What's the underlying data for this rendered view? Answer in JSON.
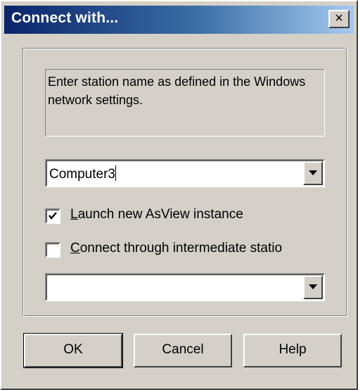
{
  "window": {
    "title": "Connect with...",
    "close_glyph": "×"
  },
  "info_text": "Enter station name as defined in the Windows network settings.",
  "station_combo": {
    "value": "Computer3",
    "dropdown_icon": "chevron-down-icon"
  },
  "launch_checkbox": {
    "mnemonic": "L",
    "label_rest": "aunch new AsView instance",
    "checked": true
  },
  "intermediate_checkbox": {
    "mnemonic": "C",
    "label_rest": "onnect through intermediate statio",
    "checked": false
  },
  "intermediate_combo": {
    "value": "",
    "dropdown_icon": "chevron-down-icon"
  },
  "buttons": {
    "ok": "OK",
    "cancel": "Cancel",
    "help": "Help"
  },
  "colors": {
    "face": "#d4d0c8",
    "title_gradient_start": "#0a246a",
    "title_gradient_end": "#a6caf0"
  }
}
